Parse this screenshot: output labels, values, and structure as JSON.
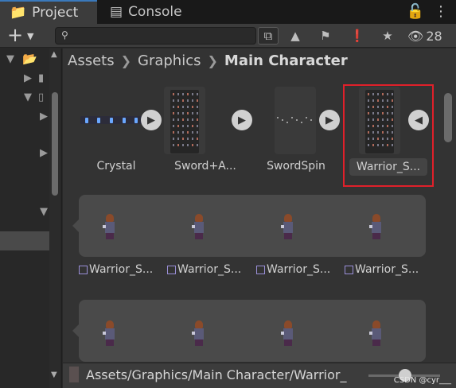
{
  "tabs": {
    "project_label": "Project",
    "console_label": "Console"
  },
  "toolbar": {
    "create_label": "+",
    "search_placeholder": "",
    "hidden_count": "28"
  },
  "breadcrumb": {
    "items": [
      "Assets",
      "Graphics",
      "Main Character"
    ]
  },
  "assets": [
    {
      "name": "Crystal"
    },
    {
      "name": "Sword+A..."
    },
    {
      "name": "SwordSpin"
    },
    {
      "name": "Warrior_S..."
    }
  ],
  "sprite_row_1": [
    {
      "name": "Warrior_S..."
    },
    {
      "name": "Warrior_S..."
    },
    {
      "name": "Warrior_S..."
    },
    {
      "name": "Warrior_S..."
    }
  ],
  "footer": {
    "path": "Assets/Graphics/Main Character/Warrior_",
    "watermark": "CSDN @cyr___"
  },
  "colors": {
    "selection_highlight": "#e0202a",
    "tab_accent": "#3a79bb"
  }
}
